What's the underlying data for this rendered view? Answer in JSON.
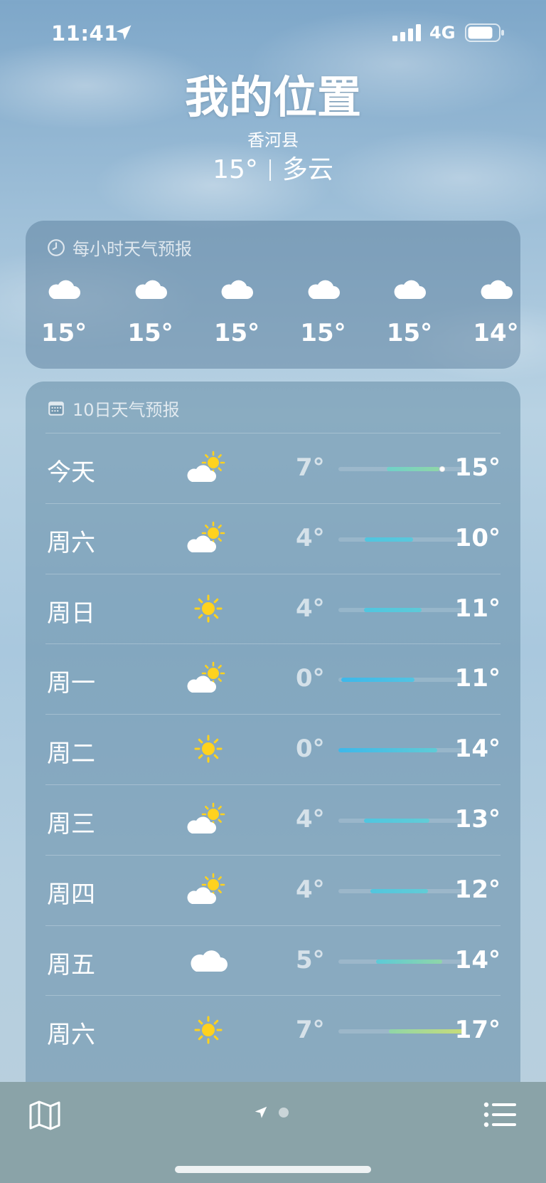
{
  "status_bar": {
    "time": "11:41",
    "network": "4G",
    "icons": [
      "location-arrow-icon",
      "signal-icon",
      "battery-icon"
    ]
  },
  "header": {
    "location": "我的位置",
    "sublocation": "香河县",
    "current_temp": "15°",
    "condition": "多云"
  },
  "hourly": {
    "title": "每小时天气预报",
    "icon": "clock-icon",
    "items": [
      {
        "icon": "cloud-icon",
        "temp": "15°"
      },
      {
        "icon": "cloud-icon",
        "temp": "15°"
      },
      {
        "icon": "cloud-icon",
        "temp": "15°"
      },
      {
        "icon": "cloud-icon",
        "temp": "15°"
      },
      {
        "icon": "cloud-icon",
        "temp": "15°"
      },
      {
        "icon": "cloud-icon",
        "temp": "14°"
      }
    ]
  },
  "daily": {
    "title": "10日天气预报",
    "icon": "calendar-icon",
    "items": [
      {
        "day": "今天",
        "icon": "partly-sunny-icon",
        "low": "7°",
        "high": "15°",
        "bar_start": 0.38,
        "bar_end": 0.8,
        "current": 0.82,
        "colors": [
          "#6fd1c9",
          "#8fd6a8"
        ]
      },
      {
        "day": "周六",
        "icon": "partly-sunny-icon",
        "low": "4°",
        "high": "10°",
        "bar_start": 0.21,
        "bar_end": 0.59,
        "colors": [
          "#4fc6e0",
          "#5ac8dc"
        ]
      },
      {
        "day": "周日",
        "icon": "sun-icon",
        "low": "4°",
        "high": "11°",
        "bar_start": 0.2,
        "bar_end": 0.66,
        "colors": [
          "#4fc6e0",
          "#5dcad8"
        ]
      },
      {
        "day": "周一",
        "icon": "partly-sunny-icon",
        "low": "0°",
        "high": "11°",
        "bar_start": 0.02,
        "bar_end": 0.6,
        "colors": [
          "#3db8ea",
          "#52c4e2"
        ]
      },
      {
        "day": "周二",
        "icon": "sun-icon",
        "low": "0°",
        "high": "14°",
        "bar_start": 0.0,
        "bar_end": 0.78,
        "colors": [
          "#3db8ea",
          "#5fcbd6"
        ]
      },
      {
        "day": "周三",
        "icon": "partly-sunny-icon",
        "low": "4°",
        "high": "13°",
        "bar_start": 0.2,
        "bar_end": 0.72,
        "colors": [
          "#4fc6e0",
          "#62ccd6"
        ]
      },
      {
        "day": "周四",
        "icon": "partly-sunny-icon",
        "low": "4°",
        "high": "12°",
        "bar_start": 0.25,
        "bar_end": 0.71,
        "colors": [
          "#52c6de",
          "#62ccd6"
        ]
      },
      {
        "day": "周五",
        "icon": "cloud-icon",
        "low": "5°",
        "high": "14°",
        "bar_start": 0.3,
        "bar_end": 0.82,
        "colors": [
          "#5ccad8",
          "#8fd6a8"
        ]
      },
      {
        "day": "周六",
        "icon": "sun-icon",
        "low": "7°",
        "high": "17°",
        "bar_start": 0.4,
        "bar_end": 1.0,
        "colors": [
          "#8fd6a8",
          "#c9dc78"
        ]
      }
    ]
  },
  "bottom_bar": {
    "map_icon": "map-icon",
    "page_indicator": [
      "location-arrow-icon",
      "page-dot"
    ],
    "list_icon": "list-icon"
  }
}
